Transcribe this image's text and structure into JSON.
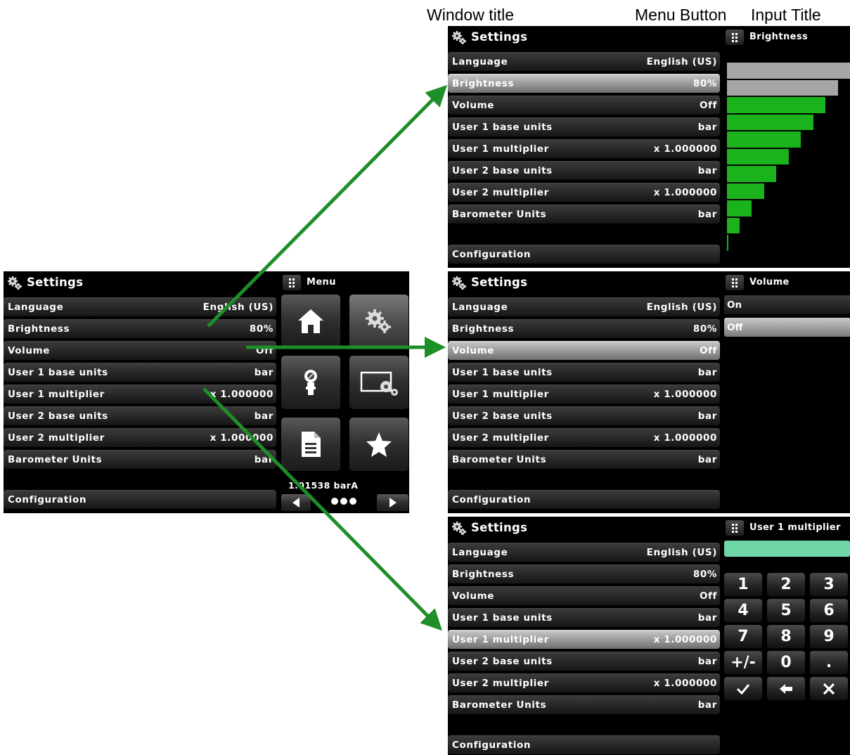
{
  "annotations": {
    "window_title": "Window title",
    "menu_button": "Menu Button",
    "input_title": "Input Title"
  },
  "settings": {
    "title": "Settings",
    "rows": [
      {
        "label": "Language",
        "value": "English (US)"
      },
      {
        "label": "Brightness",
        "value": "80%"
      },
      {
        "label": "Volume",
        "value": "Off"
      },
      {
        "label": "User 1 base units",
        "value": "bar"
      },
      {
        "label": "User 1 multiplier",
        "value": "x 1.000000"
      },
      {
        "label": "User 2 base units",
        "value": "bar"
      },
      {
        "label": "User 2 multiplier",
        "value": "x 1.000000"
      },
      {
        "label": "Barometer Units",
        "value": "bar"
      }
    ],
    "configuration": "Configuration"
  },
  "menu_panel": {
    "title": "Menu",
    "readout": "1.01538 barA",
    "tiles": [
      "home-icon",
      "settings-icon",
      "sensor-icon",
      "display-settings-icon",
      "document-icon",
      "favorites-icon"
    ]
  },
  "brightness_panel": {
    "title": "Brightness",
    "level": 0.8,
    "steps": 11,
    "active_color": "#1bb31b",
    "inactive_color": "#a6a6a6"
  },
  "volume_panel": {
    "title": "Volume",
    "options": [
      "On",
      "Off"
    ],
    "selected": "Off"
  },
  "keypad_panel": {
    "title": "User 1 multiplier",
    "input_color": "#6fd6a8",
    "keys": [
      "1",
      "2",
      "3",
      "4",
      "5",
      "6",
      "7",
      "8",
      "9",
      "+/-",
      "0",
      "."
    ],
    "actions": [
      "check-icon",
      "backspace-icon",
      "cancel-icon"
    ]
  },
  "arrow_color": "#1e8f28"
}
